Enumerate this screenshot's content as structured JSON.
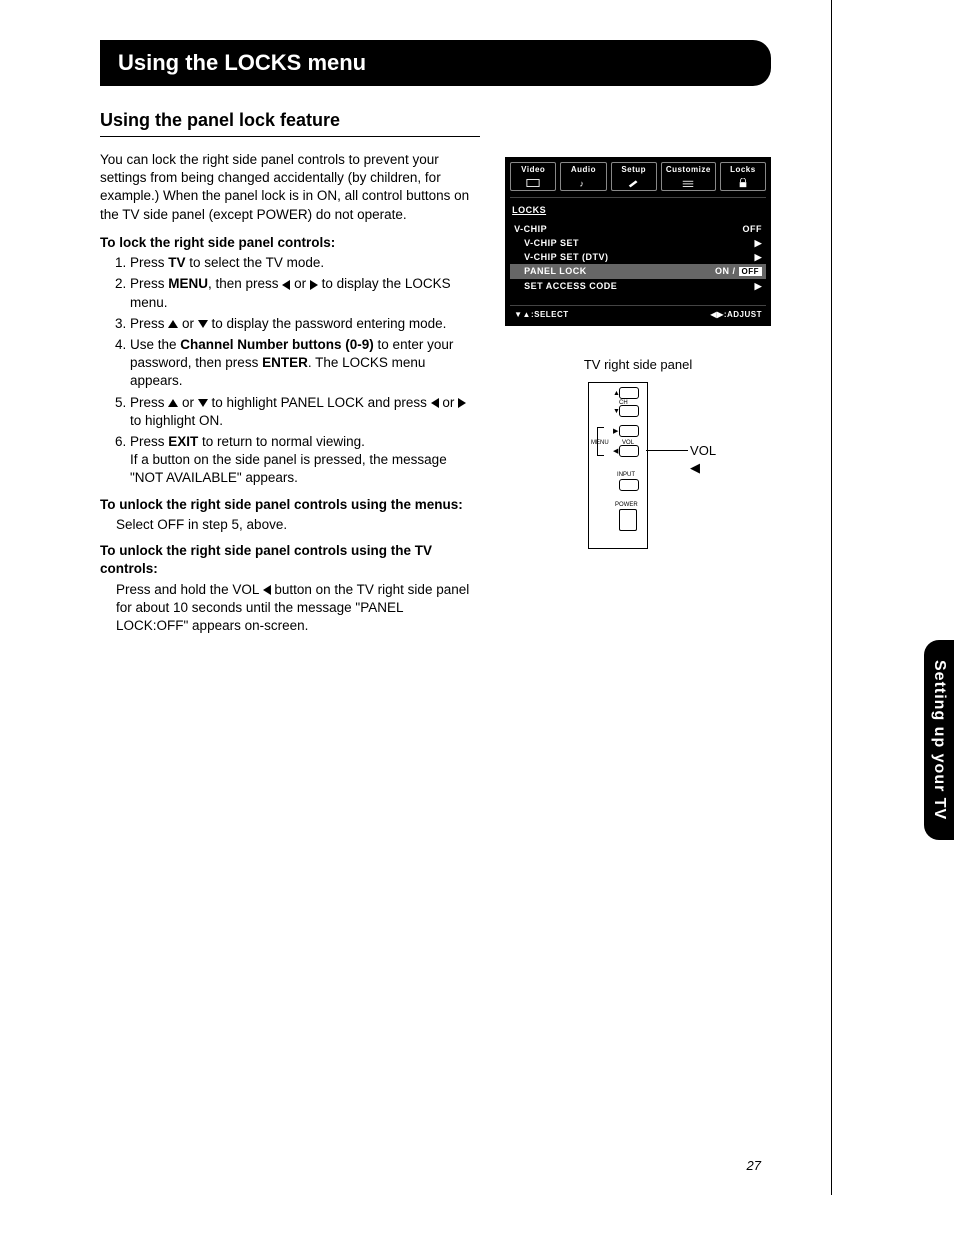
{
  "header": "Using the LOCKS menu",
  "section_title": "Using the panel lock feature",
  "intro": "You can lock the right side panel controls to prevent your settings from being changed accidentally (by children, for example.) When the panel lock is in ON, all control buttons on the TV side panel (except POWER) do not operate.",
  "lock_heading": "To lock the right side panel controls:",
  "steps": {
    "s1a": "Press ",
    "s1_tv": "TV",
    "s1b": " to select the TV mode.",
    "s2a": "Press ",
    "s2_menu": "MENU",
    "s2b": ", then press ",
    "s2c": " or ",
    "s2d": " to display the LOCKS menu.",
    "s3a": "Press ",
    "s3b": " or ",
    "s3c": " to display the password entering mode.",
    "s4a": "Use the ",
    "s4_btns": "Channel Number buttons (0-9)",
    "s4b": " to enter your password, then press ",
    "s4_enter": "ENTER",
    "s4c": ". The LOCKS menu appears.",
    "s5a": "Press ",
    "s5b": " or ",
    "s5c": " to highlight PANEL LOCK and press ",
    "s5d": " or ",
    "s5e": " to highlight ON.",
    "s6a": "Press ",
    "s6_exit": "EXIT",
    "s6b": " to return to normal viewing.",
    "s6_note": "If a button on the side panel is pressed, the message \"NOT AVAILABLE\" appears."
  },
  "unlock_menu_heading": "To unlock the right side panel controls using the menus:",
  "unlock_menu_body": "Select OFF in step 5, above.",
  "unlock_tv_heading": "To unlock the right side panel controls using the TV controls:",
  "unlock_tv_a": "Press and hold the VOL ",
  "unlock_tv_b": " button on the TV right side panel for about 10 seconds until the message \"PANEL LOCK:OFF\" appears on-screen.",
  "osd": {
    "tabs": [
      "Video",
      "Audio",
      "Setup",
      "Customize",
      "Locks"
    ],
    "title": "LOCKS",
    "rows": [
      {
        "label": "V-CHIP",
        "value": "OFF",
        "indent": false
      },
      {
        "label": "V-CHIP SET",
        "value": "▶",
        "indent": true
      },
      {
        "label": "V-CHIP SET (DTV)",
        "value": "▶",
        "indent": true
      },
      {
        "label": "PANEL LOCK",
        "value_on": "ON",
        "value_sep": " / ",
        "value_off": "OFF",
        "indent": true,
        "highlight": true
      },
      {
        "label": "SET ACCESS CODE",
        "value": "▶",
        "indent": true
      }
    ],
    "footer_left": "▼▲:SELECT",
    "footer_right": "◀▶:ADJUST"
  },
  "panel_caption": "TV right side panel",
  "panel_labels": {
    "ch": "CH",
    "menu": "MENU",
    "vol": "VOL",
    "input": "INPUT",
    "power": "POWER"
  },
  "callout": "VOL ◀",
  "side_tab": "Setting up your TV",
  "page_num": "27"
}
